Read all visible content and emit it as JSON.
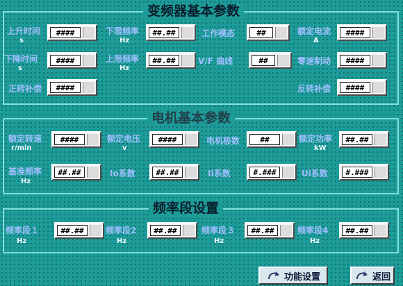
{
  "sections": {
    "vfd_params": "变频器基本参数",
    "motor_params": "电机基本参数",
    "freq_settings": "频率段设置"
  },
  "vfd": {
    "up_time": {
      "label": "上升时间",
      "unit": "s",
      "value": "####"
    },
    "down_time": {
      "label": "下降时间",
      "unit": "s",
      "value": "####"
    },
    "forward_comp": {
      "label": "正转补偿",
      "value": "####"
    },
    "lower_freq": {
      "label": "下限频率",
      "unit": "Hz",
      "value": "##.##"
    },
    "upper_freq": {
      "label": "上限频率",
      "unit": "Hz",
      "value": "##.##"
    },
    "work_mode": {
      "label": "工作模态",
      "value": "##"
    },
    "vf_curve": {
      "label": "V/F 曲线",
      "value": "##"
    },
    "rated_current": {
      "label": "额定电流",
      "unit": "A",
      "value": "####"
    },
    "zero_brake": {
      "label": "零速制动",
      "value": "####"
    },
    "reverse_comp": {
      "label": "反转补偿",
      "value": "####"
    }
  },
  "motor": {
    "rated_speed": {
      "label": "额定转速",
      "unit": "r/min",
      "value": "####"
    },
    "base_freq": {
      "label": "基准频率",
      "unit": "Hz",
      "value": "##.##"
    },
    "rated_voltage": {
      "label": "额定电压",
      "unit": "v",
      "value": "####"
    },
    "io_coef": {
      "label": "Io系数",
      "value": "##.##"
    },
    "poles": {
      "label": "电机极数",
      "value": "##"
    },
    "ii_coef": {
      "label": "Ii系数",
      "value": "#.###"
    },
    "rated_power": {
      "label": "额定功率",
      "unit": "kW",
      "value": "##.##"
    },
    "ui_coef": {
      "label": "Ui系数",
      "value": "#.###"
    }
  },
  "freq": {
    "seg1": {
      "label": "频率段１",
      "unit": "Hz",
      "value": "##.##"
    },
    "seg2": {
      "label": "频率段2",
      "unit": "Hz",
      "value": "##.##"
    },
    "seg3": {
      "label": "频率段３",
      "unit": "Hz",
      "value": "##.##"
    },
    "seg4": {
      "label": "频率段4",
      "unit": "Hz",
      "value": "##.##"
    }
  },
  "buttons": {
    "function_settings": "功能设置",
    "back": "返回",
    "icon": "curved-arrow-icon"
  },
  "colors": {
    "background": "#1d9b98",
    "label": "#9fc0ff",
    "border": "#7fe0dc"
  }
}
